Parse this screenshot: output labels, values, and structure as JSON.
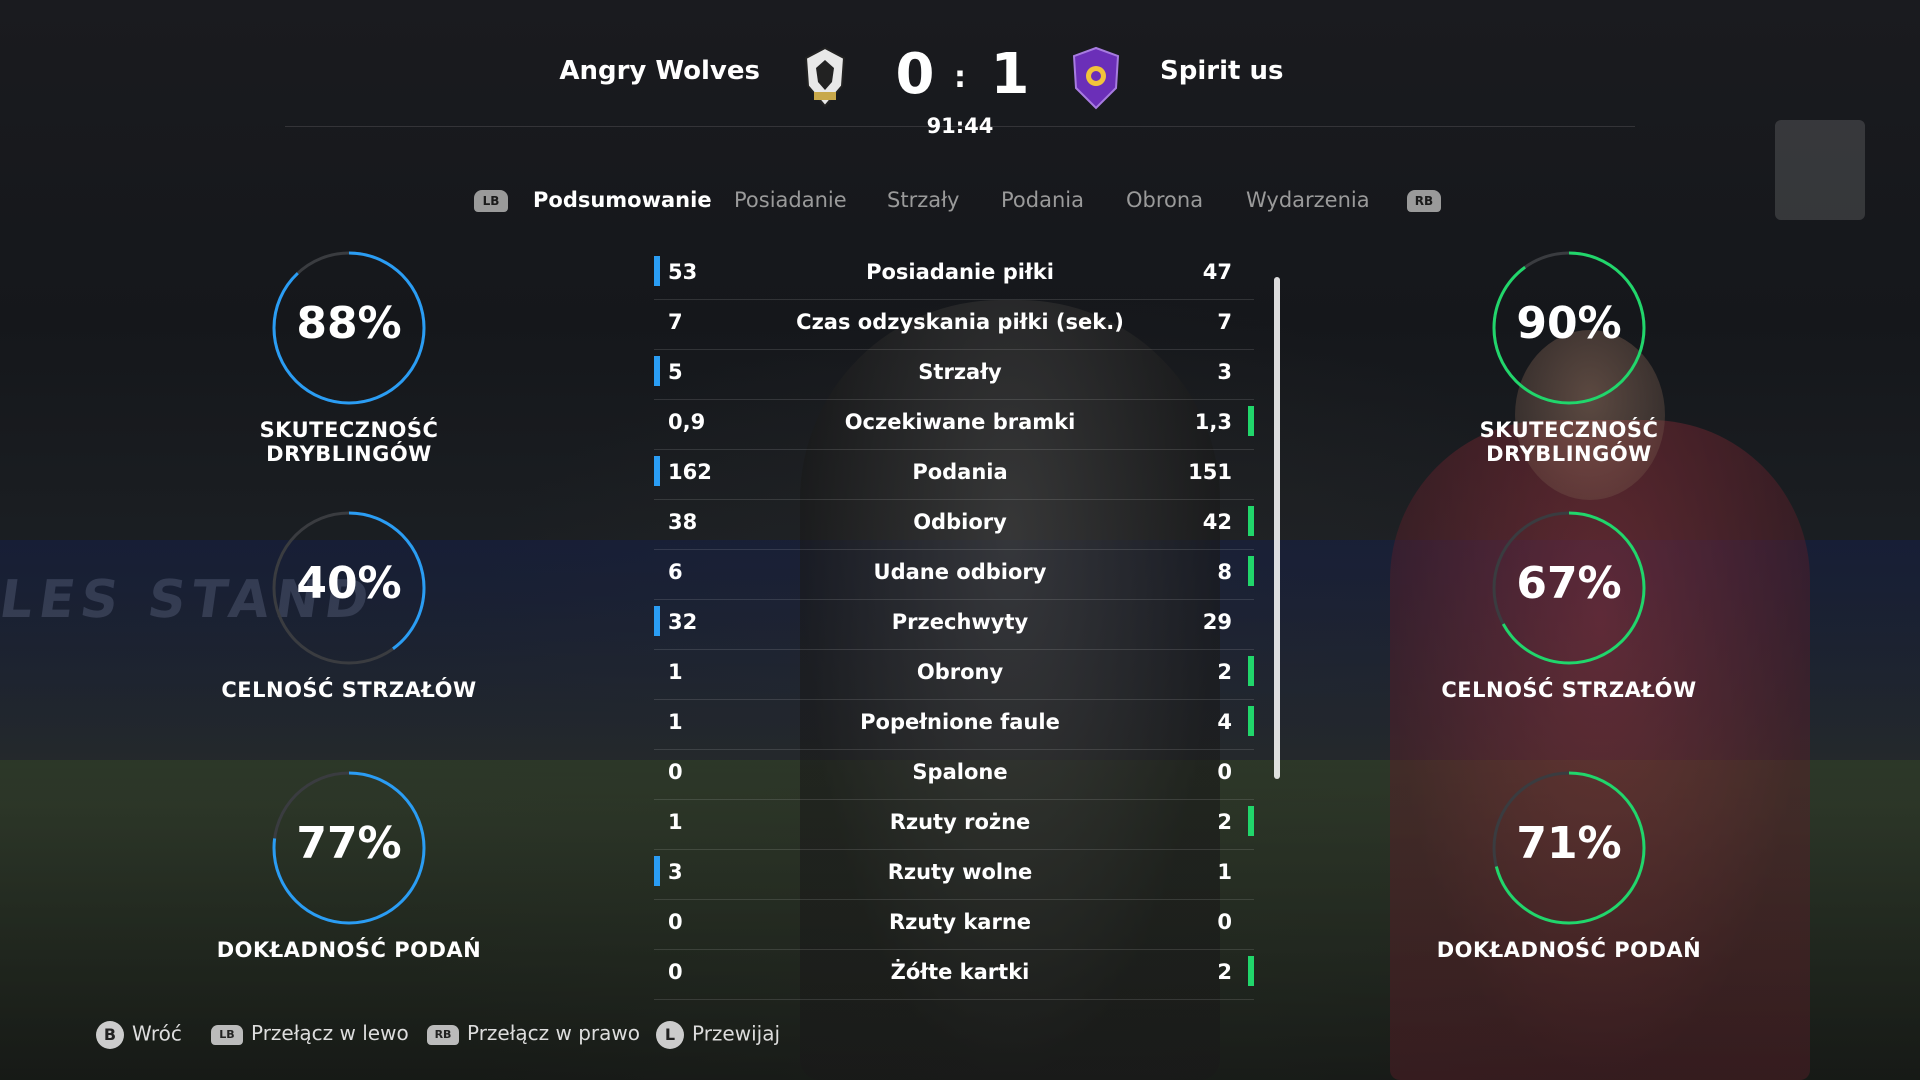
{
  "match": {
    "home_team": "Angry Wolves",
    "away_team": "Spirit us",
    "home_score": "0",
    "separator": ":",
    "away_score": "1",
    "clock": "91:44"
  },
  "tabs": {
    "left_bumper": "LB",
    "right_bumper": "RB",
    "items": [
      "Podsumowanie",
      "Posiadanie",
      "Strzały",
      "Podania",
      "Obrona",
      "Wydarzenia"
    ],
    "active": "Podsumowanie"
  },
  "stats": [
    {
      "label": "Posiadanie piłki",
      "home": "53",
      "away": "47",
      "lead": "home"
    },
    {
      "label": "Czas odzyskania piłki (sek.)",
      "home": "7",
      "away": "7",
      "lead": "none"
    },
    {
      "label": "Strzały",
      "home": "5",
      "away": "3",
      "lead": "home"
    },
    {
      "label": "Oczekiwane bramki",
      "home": "0,9",
      "away": "1,3",
      "lead": "away"
    },
    {
      "label": "Podania",
      "home": "162",
      "away": "151",
      "lead": "home"
    },
    {
      "label": "Odbiory",
      "home": "38",
      "away": "42",
      "lead": "away"
    },
    {
      "label": "Udane odbiory",
      "home": "6",
      "away": "8",
      "lead": "away"
    },
    {
      "label": "Przechwyty",
      "home": "32",
      "away": "29",
      "lead": "home"
    },
    {
      "label": "Obrony",
      "home": "1",
      "away": "2",
      "lead": "away"
    },
    {
      "label": "Popełnione faule",
      "home": "1",
      "away": "4",
      "lead": "away"
    },
    {
      "label": "Spalone",
      "home": "0",
      "away": "0",
      "lead": "none"
    },
    {
      "label": "Rzuty rożne",
      "home": "1",
      "away": "2",
      "lead": "away"
    },
    {
      "label": "Rzuty wolne",
      "home": "3",
      "away": "1",
      "lead": "home"
    },
    {
      "label": "Rzuty karne",
      "home": "0",
      "away": "0",
      "lead": "none"
    },
    {
      "label": "Żółte kartki",
      "home": "0",
      "away": "2",
      "lead": "away"
    }
  ],
  "home_rings": [
    {
      "value": "88%",
      "fraction": 0.88,
      "label": "SKUTECZNOŚĆ DRYBLINGÓW"
    },
    {
      "value": "40%",
      "fraction": 0.4,
      "label": "CELNOŚĆ STRZAŁÓW"
    },
    {
      "value": "77%",
      "fraction": 0.77,
      "label": "DOKŁADNOŚĆ PODAŃ"
    }
  ],
  "away_rings": [
    {
      "value": "90%",
      "fraction": 0.9,
      "label": "SKUTECZNOŚĆ DRYBLINGÓW"
    },
    {
      "value": "67%",
      "fraction": 0.67,
      "label": "CELNOŚĆ STRZAŁÓW"
    },
    {
      "value": "71%",
      "fraction": 0.71,
      "label": "DOKŁADNOŚĆ PODAŃ"
    }
  ],
  "colors": {
    "home": "#2a9df4",
    "away": "#21d66b",
    "ring_track": "#3a3c40"
  },
  "footer": {
    "back_key": "B",
    "back": "Wróć",
    "left_key": "LB",
    "left": "Przełącz w lewo",
    "right_key": "RB",
    "right": "Przełącz w prawo",
    "scroll_key": "L",
    "scroll": "Przewijaj"
  }
}
